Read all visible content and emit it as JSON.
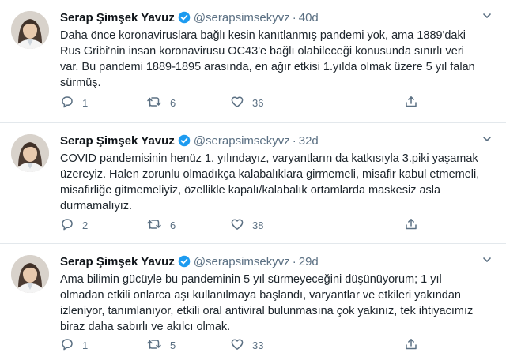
{
  "tweets": [
    {
      "name": "Serap Şimşek Yavuz",
      "handle": "@serapsimsekyvz",
      "time": "40d",
      "lines": [
        "Daha önce koronaviruslara bağlı kesin kanıtlanmış pandemi yok, ama 1889'daki",
        "Rus Gribi'nin  insan koronavirusu OC43'e bağlı olabileceği konusunda sınırlı veri",
        "var. Bu pandemi 1889-1895 arasında, en ağır etkisi 1.yılda olmak üzere 5 yıl falan",
        "sürmüş."
      ],
      "replies": "1",
      "retweets": "6",
      "likes": "36"
    },
    {
      "name": "Serap Şimşek Yavuz",
      "handle": "@serapsimsekyvz",
      "time": "32d",
      "lines": [
        "COVID pandemisinin henüz 1. yılındayız, varyantların da katkısıyla 3.piki yaşamak",
        "üzereyiz. Halen zorunlu olmadıkça kalabalıklara girmemeli, misafir kabul etmemeli,",
        "misafirliğe gitmemeliyiz, özellikle kapalı/kalabalık ortamlarda maskesiz asla",
        "durmamalıyız."
      ],
      "replies": "2",
      "retweets": "6",
      "likes": "38"
    },
    {
      "name": "Serap Şimşek Yavuz",
      "handle": "@serapsimsekyvz",
      "time": "29d",
      "lines": [
        "Ama bilimin gücüyle bu pandeminin 5 yıl sürmeyeceğini düşünüyorum;  1 yıl",
        "olmadan etkili onlarca aşı kullanılmaya başlandı, varyantlar ve etkileri yakından",
        "izleniyor, tanımlanıyor, etkili oral antiviral bulunmasına çok yakınız, tek ihtiyacımız",
        "biraz daha sabırlı ve akılcı olmak."
      ],
      "replies": "1",
      "retweets": "5",
      "likes": "33"
    }
  ],
  "separator": "·",
  "icons": {
    "verified": "verified-badge-icon",
    "more": "more-chevron-icon",
    "reply": "reply-bubble-icon",
    "retweet": "retweet-icon",
    "like": "heart-icon",
    "share": "share-icon"
  },
  "colors": {
    "verified": "#1d9bf0",
    "secondary_text": "#5b7083",
    "text": "#0f1419"
  }
}
